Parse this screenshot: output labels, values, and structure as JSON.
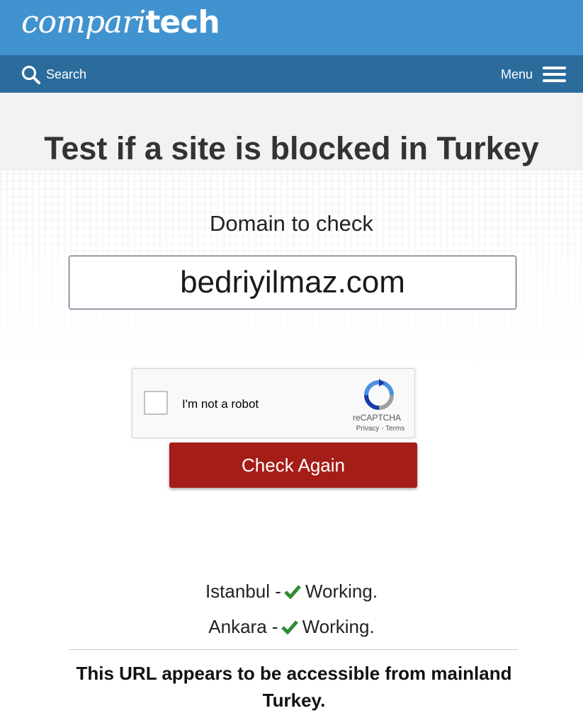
{
  "header": {
    "logo_light": "compari",
    "logo_bold": "tech",
    "search_label": "Search",
    "menu_label": "Menu"
  },
  "main": {
    "title": "Test if a site is blocked in Turkey",
    "domain_label": "Domain to check",
    "domain_value": "bedriyilmaz.com",
    "captcha": {
      "label": "I'm not a robot",
      "brand": "reCAPTCHA",
      "links": "Privacy - Terms"
    },
    "check_button": "Check Again",
    "results": [
      {
        "city": "Istanbul",
        "separator": "-",
        "status": "Working."
      },
      {
        "city": "Ankara",
        "separator": "-",
        "status": "Working."
      }
    ],
    "summary": "This URL appears to be accessible from mainland Turkey."
  },
  "colors": {
    "header_blue": "#4193cf",
    "nav_blue": "#2b6c9d",
    "button_red": "#a51d18",
    "check_green": "#2e8b2e"
  }
}
